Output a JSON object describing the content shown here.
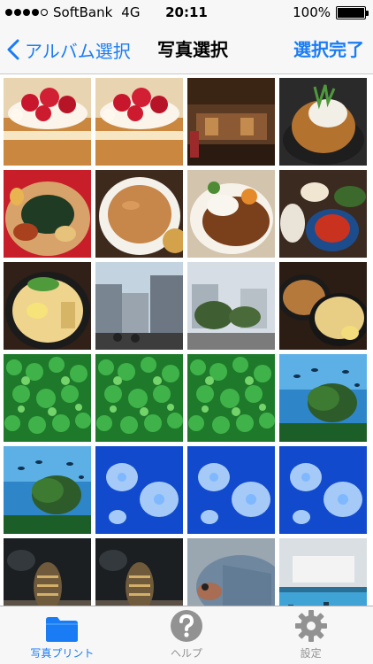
{
  "status_bar": {
    "carrier": "SoftBank",
    "network": "4G",
    "time": "20:11",
    "battery": "100%",
    "battery_level": 1.0,
    "signal_bars": 4
  },
  "nav": {
    "back_label": "アルバム選択",
    "title": "写真選択",
    "done_label": "選択完了"
  },
  "photos": [
    {
      "subject": "strawberry-shortcake"
    },
    {
      "subject": "strawberry-shortcake"
    },
    {
      "subject": "restaurant-interior"
    },
    {
      "subject": "fried-chicken-bowl"
    },
    {
      "subject": "cold-noodles"
    },
    {
      "subject": "curry-soup"
    },
    {
      "subject": "curry-rice"
    },
    {
      "subject": "set-meal"
    },
    {
      "subject": "ramen"
    },
    {
      "subject": "city-street"
    },
    {
      "subject": "city-trees"
    },
    {
      "subject": "tsukemen"
    },
    {
      "subject": "aquarium-plants"
    },
    {
      "subject": "aquarium-plants"
    },
    {
      "subject": "aquarium-plants"
    },
    {
      "subject": "aquarium-tank"
    },
    {
      "subject": "aquarium-tank"
    },
    {
      "subject": "jellyfish"
    },
    {
      "subject": "jellyfish"
    },
    {
      "subject": "jellyfish"
    },
    {
      "subject": "catfish"
    },
    {
      "subject": "catfish"
    },
    {
      "subject": "fish-closeup"
    },
    {
      "subject": "aquarium-hall"
    }
  ],
  "tabs": [
    {
      "label": "写真プリント",
      "icon": "folder-icon",
      "active": true
    },
    {
      "label": "ヘルプ",
      "icon": "question-icon",
      "active": false
    },
    {
      "label": "設定",
      "icon": "gear-icon",
      "active": false
    }
  ],
  "colors": {
    "accent": "#1a7cf5",
    "bar_background": "#f7f7f7",
    "tab_inactive": "#929292"
  }
}
